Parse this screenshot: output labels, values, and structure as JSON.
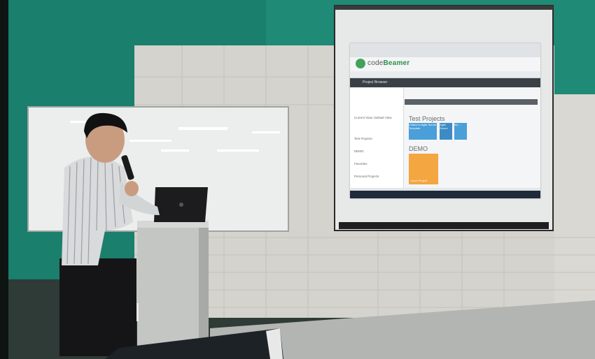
{
  "screen": {
    "app_name_prefix": "code",
    "app_name_bold": "Beamer",
    "band_label": "Project Browser",
    "section_test_projects": "Test Projects",
    "section_demo": "DEMO",
    "tile_label_1": "Collect to Agile Scrum Template",
    "tile_label_2": "Agile Scrum",
    "tile_label_3": "My ...",
    "tile_label_demo": "Issue Project",
    "sidebar_rows": [
      "Current View: Default View",
      "Test Projects",
      "DEMO",
      "Favorites",
      "Personal Projects"
    ]
  },
  "colors": {
    "teal_wall": "#1f8a76",
    "tile_blue": "#4a9fd8",
    "tile_orange": "#f4a640",
    "codebeamer_green": "#41a35a"
  }
}
